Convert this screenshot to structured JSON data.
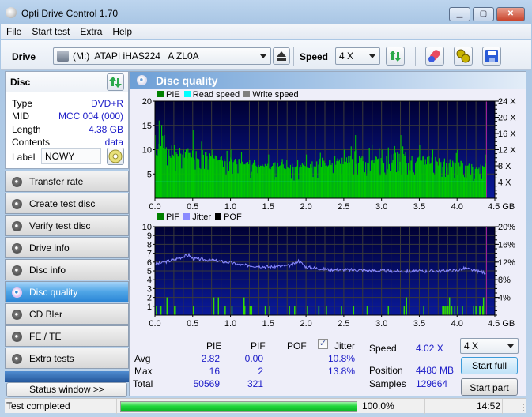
{
  "window": {
    "title": "Opti Drive Control 1.70",
    "min_label": "▁",
    "max_label": "▢",
    "close_label": "✕"
  },
  "menu": [
    "File",
    "Start test",
    "Extra",
    "Help"
  ],
  "toolbar": {
    "drive_label": "Drive",
    "drive_value": "(M:)  ATAPI iHAS224   A ZL0A",
    "speed_label": "Speed",
    "speed_value": "4 X",
    "icons": [
      "eject-icon",
      "refresh-icon",
      "erase-icon",
      "settings-icon",
      "save-icon"
    ]
  },
  "disc": {
    "header": "Disc",
    "fields": [
      {
        "label": "Type",
        "value": "DVD+R"
      },
      {
        "label": "MID",
        "value": "MCC 004 (000)"
      },
      {
        "label": "Length",
        "value": "4.38 GB"
      },
      {
        "label": "Contents",
        "value": "data"
      }
    ],
    "label_label": "Label",
    "label_value": "NOWY"
  },
  "nav": [
    {
      "label": "Transfer rate",
      "active": false
    },
    {
      "label": "Create test disc",
      "active": false
    },
    {
      "label": "Verify test disc",
      "active": false
    },
    {
      "label": "Drive info",
      "active": false
    },
    {
      "label": "Disc info",
      "active": false
    },
    {
      "label": "Disc quality",
      "active": true
    },
    {
      "label": "CD Bler",
      "active": false
    },
    {
      "label": "FE / TE",
      "active": false
    },
    {
      "label": "Extra tests",
      "active": false
    }
  ],
  "status_window_label": "Status window >>",
  "panel": {
    "title": "Disc quality"
  },
  "colors": {
    "pie": "#00c800",
    "read_speed": "#00ffff",
    "write_speed": "#808080",
    "pif": "#00c800",
    "jitter": "#8a8aff",
    "pof": "#000000",
    "plot_bg_top": "#000033",
    "plot_bg_bottom": "#0a1a9a",
    "grid": "#3a3a3a",
    "end_marker": "#a020a0"
  },
  "chart_data": [
    {
      "type": "bar",
      "title": "PIE / Read speed",
      "legend": [
        {
          "name": "PIE",
          "color": "#008000"
        },
        {
          "name": "Read speed",
          "color": "#00ffff"
        },
        {
          "name": "Write speed",
          "color": "#808080"
        }
      ],
      "xlabel": "GB",
      "x_ticks": [
        "0.0",
        "0.5",
        "1.0",
        "1.5",
        "2.0",
        "2.5",
        "3.0",
        "3.5",
        "4.0",
        "4.5"
      ],
      "xlim": [
        0,
        4.5
      ],
      "y_ticks": [
        "5",
        "10",
        "15",
        "20"
      ],
      "ylim": [
        0,
        20
      ],
      "y2_ticks": [
        "4 X",
        "8 X",
        "12 X",
        "16 X",
        "20 X",
        "24 X"
      ],
      "y2lim": [
        0,
        24
      ],
      "data_end_gb": 4.38,
      "read_speed_x": 4.02,
      "pie_profile": [
        {
          "gb": 0.0,
          "base": 8,
          "peak": 13
        },
        {
          "gb": 0.05,
          "base": 9,
          "peak": 16
        },
        {
          "gb": 0.25,
          "base": 8,
          "peak": 11
        },
        {
          "gb": 0.5,
          "base": 8,
          "peak": 14
        },
        {
          "gb": 0.75,
          "base": 8,
          "peak": 10
        },
        {
          "gb": 1.0,
          "base": 7,
          "peak": 10
        },
        {
          "gb": 1.5,
          "base": 6,
          "peak": 9
        },
        {
          "gb": 2.0,
          "base": 6,
          "peak": 9
        },
        {
          "gb": 2.5,
          "base": 7,
          "peak": 10
        },
        {
          "gb": 2.65,
          "base": 7,
          "peak": 13
        },
        {
          "gb": 3.0,
          "base": 7,
          "peak": 10
        },
        {
          "gb": 3.25,
          "base": 7,
          "peak": 13
        },
        {
          "gb": 3.5,
          "base": 7,
          "peak": 11
        },
        {
          "gb": 4.0,
          "base": 6,
          "peak": 10
        },
        {
          "gb": 4.38,
          "base": 6,
          "peak": 9
        }
      ]
    },
    {
      "type": "bar",
      "title": "PIF / Jitter",
      "legend": [
        {
          "name": "PIF",
          "color": "#008000"
        },
        {
          "name": "Jitter",
          "color": "#8a8aff"
        },
        {
          "name": "POF",
          "color": "#000000"
        }
      ],
      "xlabel": "GB",
      "x_ticks": [
        "0.0",
        "0.5",
        "1.0",
        "1.5",
        "2.0",
        "2.5",
        "3.0",
        "3.5",
        "4.0",
        "4.5"
      ],
      "xlim": [
        0,
        4.5
      ],
      "y_ticks": [
        "1",
        "2",
        "3",
        "4",
        "5",
        "6",
        "7",
        "8",
        "9",
        "10"
      ],
      "ylim": [
        0,
        10
      ],
      "y2_ticks": [
        "4%",
        "8%",
        "12%",
        "16%",
        "20%"
      ],
      "y2lim": [
        0,
        20
      ],
      "data_end_gb": 4.38,
      "pif_events": [
        {
          "gb": 0.02,
          "v": 1
        },
        {
          "gb": 0.07,
          "v": 1
        },
        {
          "gb": 0.08,
          "v": 1
        },
        {
          "gb": 0.16,
          "v": 2
        },
        {
          "gb": 0.26,
          "v": 1
        },
        {
          "gb": 0.27,
          "v": 1
        },
        {
          "gb": 0.51,
          "v": 1
        },
        {
          "gb": 0.78,
          "v": 2
        },
        {
          "gb": 0.84,
          "v": 2
        },
        {
          "gb": 0.93,
          "v": 1
        },
        {
          "gb": 1.02,
          "v": 1
        },
        {
          "gb": 1.18,
          "v": 2
        },
        {
          "gb": 1.19,
          "v": 1
        },
        {
          "gb": 1.26,
          "v": 1
        },
        {
          "gb": 1.28,
          "v": 1
        },
        {
          "gb": 1.46,
          "v": 1
        },
        {
          "gb": 1.52,
          "v": 1
        },
        {
          "gb": 1.78,
          "v": 1
        },
        {
          "gb": 1.85,
          "v": 1
        },
        {
          "gb": 2.02,
          "v": 1
        },
        {
          "gb": 2.17,
          "v": 1
        },
        {
          "gb": 2.27,
          "v": 1
        },
        {
          "gb": 2.47,
          "v": 1
        },
        {
          "gb": 2.63,
          "v": 1
        },
        {
          "gb": 2.81,
          "v": 1
        },
        {
          "gb": 3.09,
          "v": 1
        },
        {
          "gb": 3.3,
          "v": 1
        },
        {
          "gb": 3.33,
          "v": 2
        },
        {
          "gb": 3.56,
          "v": 1
        },
        {
          "gb": 3.81,
          "v": 1
        },
        {
          "gb": 3.82,
          "v": 1
        },
        {
          "gb": 3.83,
          "v": 1
        },
        {
          "gb": 3.85,
          "v": 1
        },
        {
          "gb": 3.88,
          "v": 1
        },
        {
          "gb": 3.9,
          "v": 2
        },
        {
          "gb": 3.93,
          "v": 1
        },
        {
          "gb": 3.97,
          "v": 1
        },
        {
          "gb": 4.01,
          "v": 1
        },
        {
          "gb": 4.07,
          "v": 1
        },
        {
          "gb": 4.22,
          "v": 1
        },
        {
          "gb": 4.25,
          "v": 1
        },
        {
          "gb": 4.3,
          "v": 1
        },
        {
          "gb": 4.31,
          "v": 1
        },
        {
          "gb": 4.34,
          "v": 1
        },
        {
          "gb": 4.35,
          "v": 2
        }
      ],
      "jitter_profile_pct": [
        {
          "gb": 0.0,
          "v": 11.5
        },
        {
          "gb": 0.2,
          "v": 12.3
        },
        {
          "gb": 0.45,
          "v": 13.6
        },
        {
          "gb": 0.5,
          "v": 12.8
        },
        {
          "gb": 0.8,
          "v": 12.3
        },
        {
          "gb": 1.0,
          "v": 11.9
        },
        {
          "gb": 1.1,
          "v": 11.4
        },
        {
          "gb": 1.5,
          "v": 10.9
        },
        {
          "gb": 1.8,
          "v": 11.2
        },
        {
          "gb": 1.9,
          "v": 12.3
        },
        {
          "gb": 2.0,
          "v": 10.9
        },
        {
          "gb": 2.3,
          "v": 10.3
        },
        {
          "gb": 2.7,
          "v": 10.2
        },
        {
          "gb": 3.0,
          "v": 10.0
        },
        {
          "gb": 3.5,
          "v": 9.9
        },
        {
          "gb": 4.0,
          "v": 10.1
        },
        {
          "gb": 4.1,
          "v": 10.6
        },
        {
          "gb": 4.3,
          "v": 9.8
        },
        {
          "gb": 4.38,
          "v": 9.6
        }
      ]
    }
  ],
  "stats": {
    "headers": [
      "PIE",
      "PIF",
      "POF",
      "Jitter"
    ],
    "jitter_checked": true,
    "rows": [
      {
        "label": "Avg",
        "pie": "2.82",
        "pif": "0.00",
        "pof": "",
        "jitter": "10.8%"
      },
      {
        "label": "Max",
        "pie": "16",
        "pif": "2",
        "pof": "",
        "jitter": "13.8%"
      },
      {
        "label": "Total",
        "pie": "50569",
        "pif": "321",
        "pof": "",
        "jitter": ""
      }
    ]
  },
  "info": {
    "speed_label": "Speed",
    "speed_value": "4.02 X",
    "position_label": "Position",
    "position_value": "4480 MB",
    "samples_label": "Samples",
    "samples_value": "129664"
  },
  "controls": {
    "speed_select": "4 X",
    "start_full": "Start full",
    "start_part": "Start part"
  },
  "statusbar": {
    "text": "Test completed",
    "progress": 100.0,
    "progress_text": "100.0%",
    "time": "14:52"
  }
}
